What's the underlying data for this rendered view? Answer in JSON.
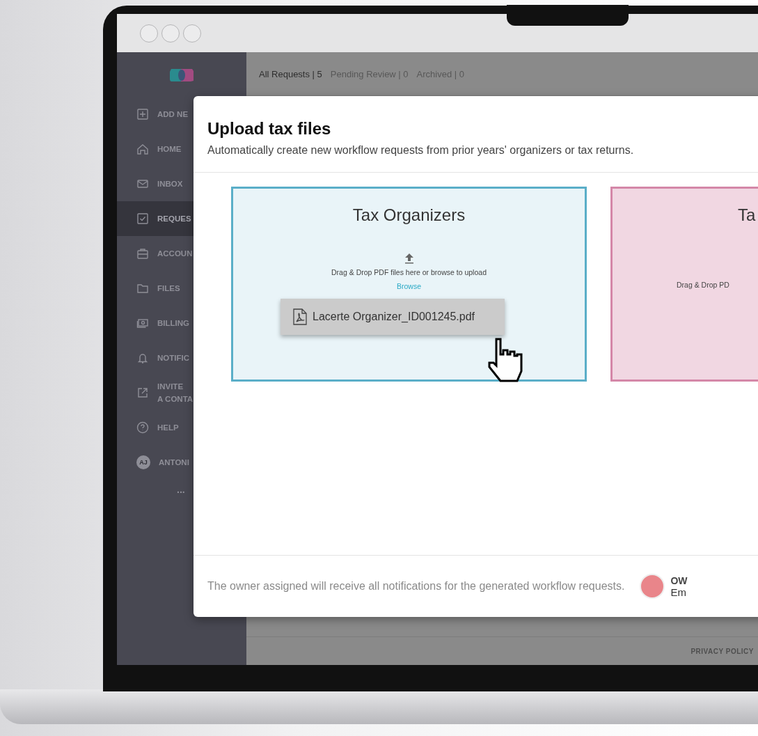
{
  "tabs": [
    {
      "label": "All Requests | 5",
      "selected": true
    },
    {
      "label": "Pending Review | 0",
      "selected": false
    },
    {
      "label": "Archived | 0",
      "selected": false
    }
  ],
  "sidebar": {
    "items": [
      {
        "label": "ADD NE",
        "selected": false
      },
      {
        "label": "HOME",
        "selected": false
      },
      {
        "label": "INBOX",
        "selected": false
      },
      {
        "label": "REQUES",
        "selected": true
      },
      {
        "label": "ACCOUN",
        "selected": false
      },
      {
        "label": "FILES",
        "selected": false
      },
      {
        "label": "BILLING",
        "selected": false
      },
      {
        "label": "NOTIFIC",
        "selected": false
      },
      {
        "label": "INVITE\nA CONTA",
        "selected": false
      },
      {
        "label": "HELP",
        "selected": false
      },
      {
        "avatar": "AJ",
        "label": "ANTONI",
        "selected": false
      }
    ],
    "more": "..."
  },
  "modal": {
    "title": "Upload tax files",
    "subtitle": "Automatically create new workflow requests from prior years' organizers or tax returns.",
    "cards": [
      {
        "title": "Tax Organizers",
        "hint": "Drag & Drop PDF files here or browse to upload",
        "browse": "Browse",
        "file": "Lacerte Organizer_ID001245.pdf",
        "color": "#5aaec8"
      },
      {
        "title": "Ta",
        "hint": "Drag & Drop PD",
        "color": "#d487a8"
      }
    ],
    "footer_note": "The owner assigned will receive all notifications for the generated workflow requests.",
    "owner": {
      "label": "OW",
      "name": "Em"
    }
  },
  "footer": {
    "link": "PRIVACY POLICY"
  }
}
